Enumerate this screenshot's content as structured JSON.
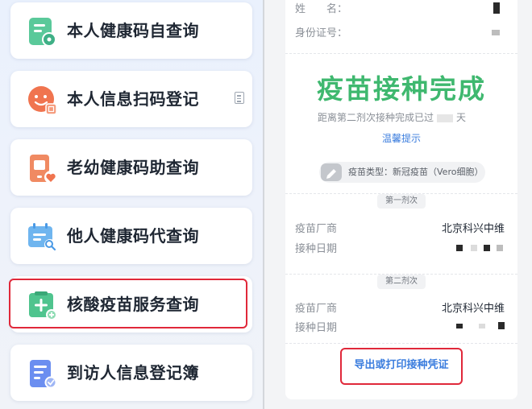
{
  "menu": {
    "items": [
      {
        "label": "本人健康码自查询",
        "icon": "health-code-icon"
      },
      {
        "label": "本人信息扫码登记",
        "icon": "scan-register-icon"
      },
      {
        "label": "老幼健康码助查询",
        "icon": "assist-query-icon"
      },
      {
        "label": "他人健康码代查询",
        "icon": "proxy-query-icon"
      },
      {
        "label": "核酸疫苗服务查询",
        "icon": "nucleic-vaccine-icon"
      },
      {
        "label": "到访人信息登记簿",
        "icon": "visitor-register-icon"
      }
    ],
    "highlighted_index": 4
  },
  "record": {
    "name_label": "姓　　名：",
    "id_label": "身份证号：",
    "status_title": "疫苗接种完成",
    "since_prefix": "距离第二剂次接种完成已过",
    "since_suffix": "天",
    "tip_link": "温馨提示",
    "vaccine_type": "疫苗类型：新冠疫苗（Vero细胞）",
    "doses": [
      {
        "tab": "第一剂次",
        "maker_label": "疫苗厂商",
        "maker": "北京科兴中维",
        "date_label": "接种日期"
      },
      {
        "tab": "第二剂次",
        "maker_label": "疫苗厂商",
        "maker": "北京科兴中维",
        "date_label": "接种日期"
      }
    ],
    "export_button": "导出或打印接种凭证"
  },
  "colors": {
    "accent_green": "#3fb86f",
    "link_blue": "#3b7dde",
    "highlight_red": "#e0283a"
  }
}
